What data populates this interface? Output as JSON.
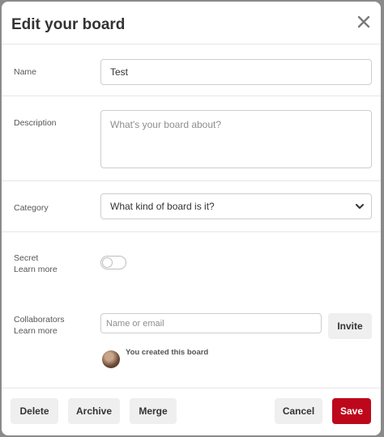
{
  "modal": {
    "title": "Edit your board"
  },
  "form": {
    "name_label": "Name",
    "name_value": "Test",
    "description_label": "Description",
    "description_placeholder": "What's your board about?",
    "category_label": "Category",
    "category_value": "What kind of board is it?",
    "secret_label": "Secret",
    "secret_learn_more": "Learn more",
    "secret_on": false,
    "collaborators_label": "Collaborators",
    "collaborators_learn_more": "Learn more",
    "collaborators_placeholder": "Name or email",
    "invite_label": "Invite",
    "owner_note": "You created this board"
  },
  "footer": {
    "delete_label": "Delete",
    "archive_label": "Archive",
    "merge_label": "Merge",
    "cancel_label": "Cancel",
    "save_label": "Save"
  },
  "colors": {
    "save_button": "#bd081c",
    "secondary_button": "#efefef",
    "backdrop": "#8a8a8a"
  },
  "icons": {
    "close": "close-icon",
    "dropdown": "chevron-down-icon"
  }
}
